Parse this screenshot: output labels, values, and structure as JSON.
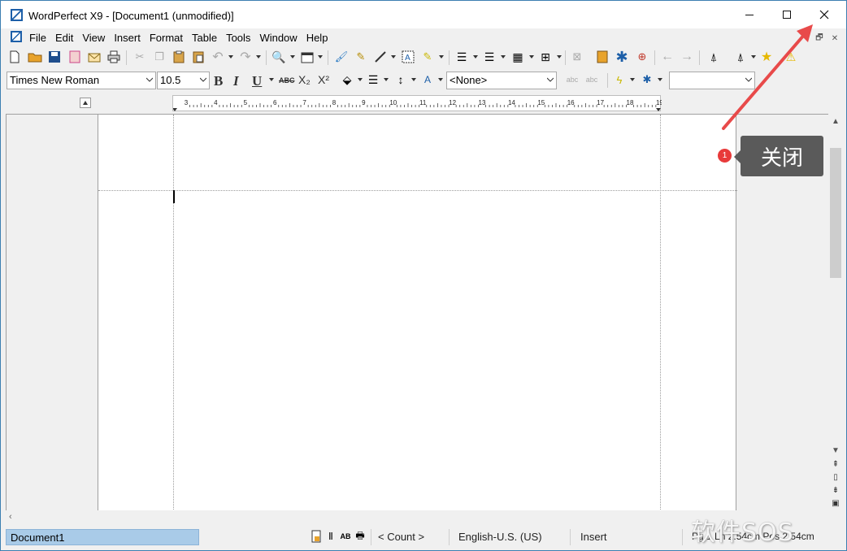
{
  "window": {
    "title": "WordPerfect X9 - [Document1 (unmodified)]"
  },
  "menu": {
    "items": [
      "File",
      "Edit",
      "View",
      "Insert",
      "Format",
      "Table",
      "Tools",
      "Window",
      "Help"
    ]
  },
  "toolbar": {
    "font_name": "Times New Roman",
    "font_size": "10.5",
    "style": "<None>",
    "zoom": "",
    "bold_label": "B",
    "italic_label": "I",
    "underline_label": "U",
    "strike_label": "ABC",
    "subscript_label": "X₂",
    "superscript_label": "X²"
  },
  "ruler": {
    "numbers": [
      "3",
      "4",
      "5",
      "6",
      "7",
      "8",
      "9",
      "10",
      "11",
      "12",
      "13",
      "14",
      "15",
      "16",
      "17",
      "18",
      "19"
    ]
  },
  "status": {
    "document": "Document1",
    "count": "< Count >",
    "language": "English-U.S. (US)",
    "mode": "Insert",
    "position": "Pg 1 Ln 2.54cm Pos 2.54cm"
  },
  "annotation": {
    "badge": "1",
    "callout": "关闭"
  },
  "watermark": {
    "text": "软件SOS"
  },
  "colors": {
    "accent": "#3c7fb1",
    "arrow": "#e84a4a",
    "callout_bg": "#5a5a5a",
    "status_doc_bg": "#a9cbe8"
  }
}
